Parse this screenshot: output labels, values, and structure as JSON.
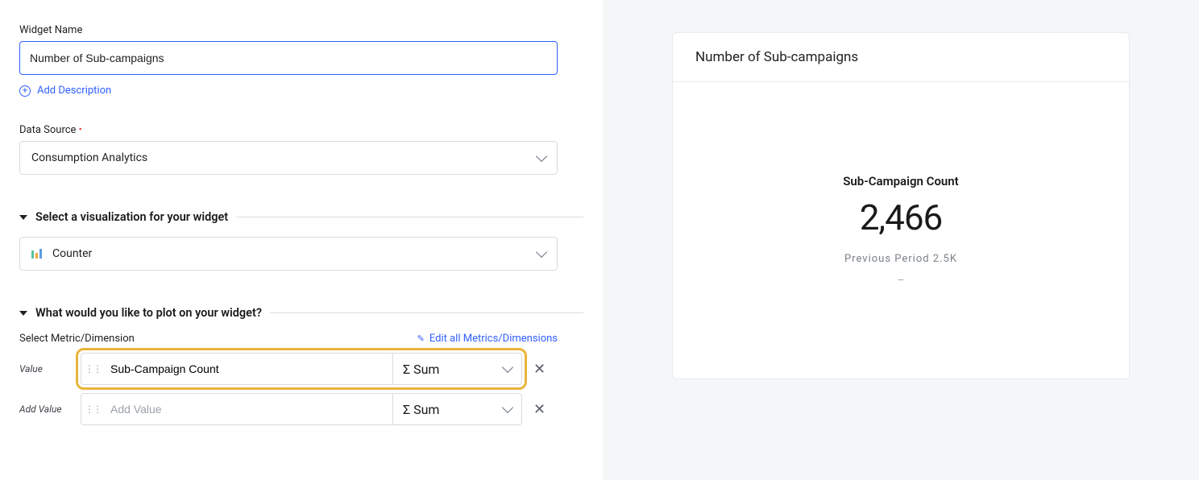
{
  "form": {
    "widget_name_label": "Widget Name",
    "widget_name_value": "Number of Sub-campaigns",
    "add_description": "Add Description",
    "data_source_label": "Data Source",
    "data_source_value": "Consumption Analytics",
    "section_viz_title": "Select a visualization for your widget",
    "viz_type": "Counter",
    "section_plot_title": "What would you like to plot on your widget?",
    "metric_dimension_label": "Select Metric/Dimension",
    "edit_all_link": "Edit all Metrics/Dimensions"
  },
  "rows": {
    "value_label": "Value",
    "value_metric": "Sub-Campaign Count",
    "value_agg": "Sum",
    "add_value_label": "Add Value",
    "add_value_placeholder": "Add Value",
    "add_value_agg": "Sum",
    "sigma": "Σ"
  },
  "preview": {
    "title": "Number of Sub-campaigns",
    "metric_title": "Sub-Campaign Count",
    "metric_value": "2,466",
    "subtext": "Previous Period 2.5K",
    "placeholder": "–"
  }
}
